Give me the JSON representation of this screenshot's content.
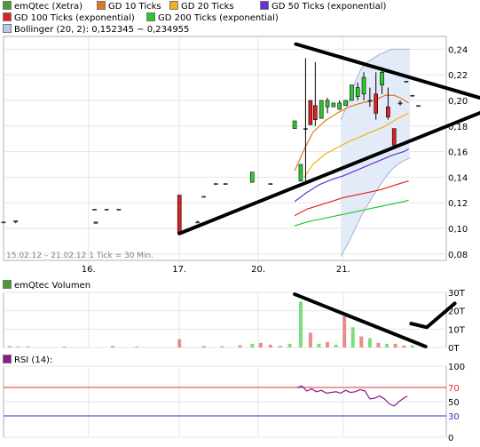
{
  "legend": {
    "row1": [
      {
        "label": "emQtec (Xetra)",
        "color": "#4c9b2f"
      },
      {
        "label": "GD 10 Ticks",
        "color": "#e0781e"
      },
      {
        "label": "GD 20 Ticks",
        "color": "#f2b01b"
      },
      {
        "label": "GD 50 Ticks (exponential)",
        "color": "#6a2fd6"
      }
    ],
    "row2": [
      {
        "label": "GD 100 Ticks (exponential)",
        "color": "#e02020"
      },
      {
        "label": "GD 200 Ticks (exponential)",
        "color": "#2ec42e"
      }
    ],
    "row3": [
      {
        "label": "Bollinger (20, 2): 0,152345 − 0,234955",
        "color": "#b8c8e8"
      }
    ]
  },
  "panels": {
    "volume_label": "emQtec Volumen",
    "volume_color": "#4c9b2f",
    "rsi_label": "RSI (14):",
    "rsi_color": "#8b1a8b"
  },
  "chart_data": [
    {
      "type": "candlestick",
      "info": "15.02.12 – 21.02.12   1 Tick = 30 Min.",
      "x_ticks": [
        "16.",
        "17.",
        "20.",
        "21."
      ],
      "y_ticks": [
        "0,24",
        "0,22",
        "0,20",
        "0,18",
        "0,16",
        "0,14",
        "0,12",
        "0,10",
        "0,08"
      ],
      "ylim": [
        0.075,
        0.25
      ],
      "up_color": "#2ecc2e",
      "down_color": "#dd2020",
      "candles": [
        {
          "x": 0.0,
          "o": 0.105,
          "h": 0.105,
          "l": 0.105,
          "c": 0.105
        },
        {
          "x": 1.0,
          "o": 0.105,
          "h": 0.106,
          "l": 0.104,
          "c": 0.106
        },
        {
          "x": 7.5,
          "o": 0.115,
          "h": 0.115,
          "l": 0.115,
          "c": 0.115
        },
        {
          "x": 8.5,
          "o": 0.115,
          "h": 0.115,
          "l": 0.115,
          "c": 0.115
        },
        {
          "x": 9.5,
          "o": 0.115,
          "h": 0.115,
          "l": 0.115,
          "c": 0.115
        },
        {
          "x": 7.6,
          "o": 0.105,
          "h": 0.105,
          "l": 0.104,
          "c": 0.104
        },
        {
          "x": 14.5,
          "o": 0.126,
          "h": 0.126,
          "l": 0.096,
          "c": 0.096
        },
        {
          "x": 16.0,
          "o": 0.105,
          "h": 0.106,
          "l": 0.104,
          "c": 0.105
        },
        {
          "x": 16.5,
          "o": 0.125,
          "h": 0.125,
          "l": 0.125,
          "c": 0.125
        },
        {
          "x": 17.5,
          "o": 0.135,
          "h": 0.135,
          "l": 0.135,
          "c": 0.135
        },
        {
          "x": 18.3,
          "o": 0.135,
          "h": 0.135,
          "l": 0.135,
          "c": 0.135
        },
        {
          "x": 20.5,
          "o": 0.136,
          "h": 0.144,
          "l": 0.136,
          "c": 0.144
        },
        {
          "x": 22.0,
          "o": 0.135,
          "h": 0.135,
          "l": 0.135,
          "c": 0.135
        },
        {
          "x": 24.0,
          "o": 0.178,
          "h": 0.184,
          "l": 0.178,
          "c": 0.184
        },
        {
          "x": 24.5,
          "o": 0.137,
          "h": 0.15,
          "l": 0.137,
          "c": 0.15
        },
        {
          "x": 24.9,
          "o": 0.178,
          "h": 0.233,
          "l": 0.137,
          "c": 0.178
        },
        {
          "x": 25.3,
          "o": 0.2,
          "h": 0.2,
          "l": 0.181,
          "c": 0.181
        },
        {
          "x": 25.7,
          "o": 0.196,
          "h": 0.23,
          "l": 0.18,
          "c": 0.185
        },
        {
          "x": 26.2,
          "o": 0.186,
          "h": 0.2,
          "l": 0.186,
          "c": 0.2
        },
        {
          "x": 26.7,
          "o": 0.195,
          "h": 0.202,
          "l": 0.19,
          "c": 0.2
        },
        {
          "x": 27.2,
          "o": 0.195,
          "h": 0.198,
          "l": 0.195,
          "c": 0.198
        },
        {
          "x": 27.7,
          "o": 0.193,
          "h": 0.2,
          "l": 0.193,
          "c": 0.198
        },
        {
          "x": 28.2,
          "o": 0.196,
          "h": 0.2,
          "l": 0.196,
          "c": 0.2
        },
        {
          "x": 28.7,
          "o": 0.2,
          "h": 0.212,
          "l": 0.2,
          "c": 0.212
        },
        {
          "x": 29.2,
          "o": 0.203,
          "h": 0.214,
          "l": 0.2,
          "c": 0.21
        },
        {
          "x": 29.7,
          "o": 0.205,
          "h": 0.222,
          "l": 0.2,
          "c": 0.218
        },
        {
          "x": 30.2,
          "o": 0.2,
          "h": 0.21,
          "l": 0.195,
          "c": 0.2
        },
        {
          "x": 30.7,
          "o": 0.205,
          "h": 0.222,
          "l": 0.185,
          "c": 0.19
        },
        {
          "x": 31.2,
          "o": 0.212,
          "h": 0.226,
          "l": 0.205,
          "c": 0.222
        },
        {
          "x": 31.7,
          "o": 0.195,
          "h": 0.21,
          "l": 0.185,
          "c": 0.187
        },
        {
          "x": 32.2,
          "o": 0.178,
          "h": 0.178,
          "l": 0.165,
          "c": 0.165
        },
        {
          "x": 32.7,
          "o": 0.198,
          "h": 0.2,
          "l": 0.196,
          "c": 0.198
        },
        {
          "x": 33.2,
          "o": 0.215,
          "h": 0.215,
          "l": 0.215,
          "c": 0.215
        },
        {
          "x": 33.7,
          "o": 0.204,
          "h": 0.204,
          "l": 0.204,
          "c": 0.204
        },
        {
          "x": 34.2,
          "o": 0.196,
          "h": 0.196,
          "l": 0.196,
          "c": 0.196
        }
      ],
      "series": [
        {
          "name": "GD 10 Ticks",
          "color": "#e0781e",
          "x": [
            24.0,
            24.8,
            25.5,
            26.5,
            27.5,
            28.5,
            29.5,
            30.5,
            31.5,
            32.2,
            32.7,
            33.4
          ],
          "values": [
            0.145,
            0.162,
            0.175,
            0.184,
            0.19,
            0.195,
            0.198,
            0.2,
            0.204,
            0.204,
            0.202,
            0.198
          ]
        },
        {
          "name": "GD 20 Ticks",
          "color": "#f2b01b",
          "x": [
            24.8,
            25.5,
            26.5,
            27.5,
            28.5,
            29.5,
            30.5,
            31.5,
            32.5,
            33.4
          ],
          "values": [
            0.14,
            0.15,
            0.158,
            0.163,
            0.168,
            0.172,
            0.176,
            0.18,
            0.186,
            0.19
          ]
        },
        {
          "name": "GD 50 Ticks (exponential)",
          "color": "#6a2fd6",
          "x": [
            24.0,
            25.0,
            26.0,
            27.0,
            28.0,
            29.0,
            30.0,
            31.0,
            32.0,
            33.0,
            33.4
          ],
          "values": [
            0.121,
            0.128,
            0.134,
            0.138,
            0.141,
            0.145,
            0.149,
            0.153,
            0.157,
            0.16,
            0.162
          ]
        },
        {
          "name": "GD 100 Ticks (exponential)",
          "color": "#e02020",
          "x": [
            24.0,
            25.0,
            26.0,
            27.0,
            28.0,
            29.0,
            30.0,
            31.0,
            32.0,
            33.0,
            33.4
          ],
          "values": [
            0.11,
            0.115,
            0.118,
            0.121,
            0.124,
            0.126,
            0.128,
            0.13,
            0.133,
            0.136,
            0.137
          ]
        },
        {
          "name": "GD 200 Ticks (exponential)",
          "color": "#2ec42e",
          "x": [
            24.0,
            25.0,
            26.0,
            27.0,
            28.0,
            29.0,
            30.0,
            31.0,
            32.0,
            33.0,
            33.4
          ],
          "values": [
            0.102,
            0.105,
            0.107,
            0.109,
            0.111,
            0.113,
            0.115,
            0.117,
            0.119,
            0.121,
            0.122
          ]
        }
      ],
      "bollinger": {
        "x": [
          27.8,
          28.5,
          29.0,
          29.5,
          30.0,
          30.5,
          31.0,
          31.5,
          32.0,
          32.5,
          33.0,
          33.5
        ],
        "upper": [
          0.185,
          0.2,
          0.215,
          0.225,
          0.23,
          0.233,
          0.236,
          0.238,
          0.24,
          0.24,
          0.24,
          0.24
        ],
        "lower": [
          0.078,
          0.09,
          0.1,
          0.11,
          0.118,
          0.126,
          0.133,
          0.14,
          0.146,
          0.15,
          0.153,
          0.155
        ]
      },
      "trendlines": [
        {
          "x": [
            24.1,
            40.0
          ],
          "values": [
            0.244,
            0.2
          ]
        },
        {
          "x": [
            14.5,
            40.0
          ],
          "values": [
            0.096,
            0.193
          ]
        }
      ]
    },
    {
      "type": "bar",
      "title": "emQtec Volumen",
      "y_ticks": [
        "30T",
        "20T",
        "10T",
        "0T"
      ],
      "ylim": [
        0,
        30
      ],
      "bars": [
        {
          "x": 0.5,
          "v": 0.8,
          "up": true
        },
        {
          "x": 1.2,
          "v": 0.6,
          "up": true
        },
        {
          "x": 2.0,
          "v": 0.6,
          "up": true
        },
        {
          "x": 5.0,
          "v": 0.5,
          "up": false
        },
        {
          "x": 9.0,
          "v": 0.8,
          "up": false
        },
        {
          "x": 11.0,
          "v": 0.6,
          "up": true
        },
        {
          "x": 14.5,
          "v": 4.5,
          "up": false
        },
        {
          "x": 16.5,
          "v": 0.8,
          "up": false
        },
        {
          "x": 18.0,
          "v": 0.6,
          "up": false
        },
        {
          "x": 19.5,
          "v": 1.2,
          "up": false
        },
        {
          "x": 20.5,
          "v": 2.0,
          "up": true
        },
        {
          "x": 21.2,
          "v": 2.5,
          "up": false
        },
        {
          "x": 22.0,
          "v": 1.5,
          "up": false
        },
        {
          "x": 22.8,
          "v": 1.0,
          "up": true
        },
        {
          "x": 23.6,
          "v": 2.0,
          "up": true
        },
        {
          "x": 24.5,
          "v": 25.0,
          "up": true
        },
        {
          "x": 25.3,
          "v": 8.0,
          "up": false
        },
        {
          "x": 26.0,
          "v": 2.0,
          "up": true
        },
        {
          "x": 26.7,
          "v": 3.0,
          "up": false
        },
        {
          "x": 27.4,
          "v": 1.5,
          "up": true
        },
        {
          "x": 28.1,
          "v": 17.0,
          "up": false
        },
        {
          "x": 28.8,
          "v": 11.0,
          "up": true
        },
        {
          "x": 29.5,
          "v": 6.0,
          "up": false
        },
        {
          "x": 30.2,
          "v": 5.0,
          "up": true
        },
        {
          "x": 30.9,
          "v": 2.5,
          "up": false
        },
        {
          "x": 31.6,
          "v": 2.0,
          "up": true
        },
        {
          "x": 32.3,
          "v": 2.0,
          "up": false
        },
        {
          "x": 33.0,
          "v": 1.0,
          "up": false
        },
        {
          "x": 33.7,
          "v": 1.2,
          "up": true
        }
      ],
      "trendlines": [
        {
          "x": [
            24.0,
            34.8
          ],
          "values": [
            29.0,
            0.5
          ]
        }
      ],
      "checkmark": {
        "x": [
          33.6,
          34.9,
          37.2
        ],
        "values": [
          13.0,
          11.0,
          24.0
        ]
      }
    },
    {
      "type": "line",
      "title": "RSI (14):",
      "y_ticks": [
        "100",
        "70",
        "50",
        "30",
        "0"
      ],
      "ylim": [
        0,
        100
      ],
      "reference_lines": [
        {
          "value": 70,
          "color": "#e03030"
        },
        {
          "value": 30,
          "color": "#3030c0"
        }
      ],
      "series": [
        {
          "name": "RSI",
          "color": "#8b1a8b",
          "x": [
            24.2,
            24.6,
            25.0,
            25.4,
            25.8,
            26.2,
            26.6,
            27.0,
            27.4,
            27.8,
            28.2,
            28.6,
            29.0,
            29.4,
            29.8,
            30.2,
            30.6,
            31.0,
            31.4,
            31.8,
            32.2,
            32.6,
            33.0,
            33.3
          ],
          "values": [
            70,
            72,
            65,
            68,
            64,
            66,
            62,
            63,
            64,
            62,
            66,
            63,
            64,
            67,
            65,
            54,
            55,
            58,
            54,
            47,
            44,
            50,
            55,
            58
          ]
        }
      ]
    }
  ]
}
